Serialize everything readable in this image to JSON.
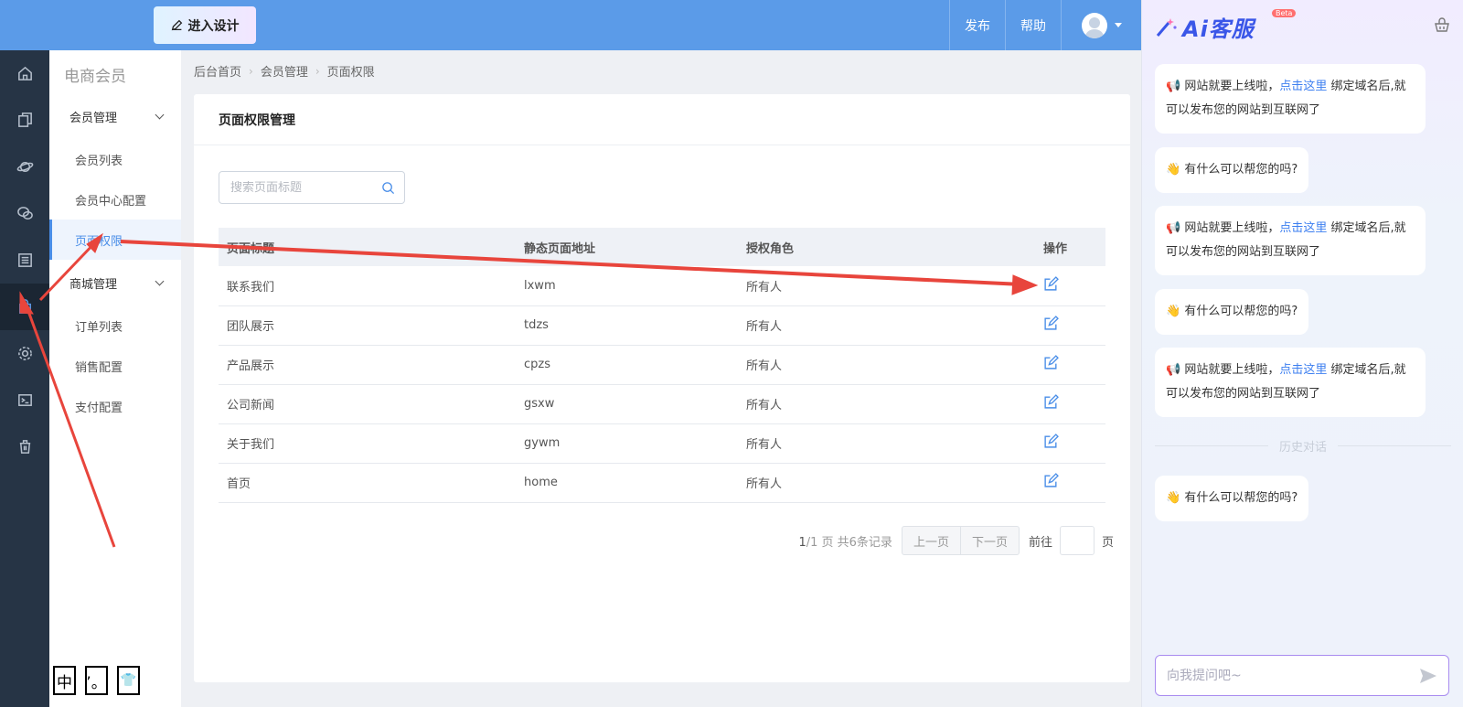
{
  "topbar": {
    "design_button": "进入设计",
    "publish": "发布",
    "help": "帮助"
  },
  "subnav": {
    "title": "电商会员",
    "groups": [
      {
        "label": "会员管理",
        "items": [
          "会员列表",
          "会员中心配置",
          "页面权限"
        ]
      },
      {
        "label": "商城管理",
        "items": [
          "订单列表",
          "销售配置",
          "支付配置"
        ]
      }
    ],
    "lang_buttons": [
      "中",
      "’。",
      "👕"
    ]
  },
  "breadcrumb": [
    "后台首页",
    "会员管理",
    "页面权限"
  ],
  "card": {
    "title": "页面权限管理",
    "search_placeholder": "搜索页面标题"
  },
  "table": {
    "headers": [
      "页面标题",
      "静态页面地址",
      "授权角色",
      "操作"
    ],
    "rows": [
      [
        "联系我们",
        "lxwm",
        "所有人"
      ],
      [
        "团队展示",
        "tdzs",
        "所有人"
      ],
      [
        "产品展示",
        "cpzs",
        "所有人"
      ],
      [
        "公司新闻",
        "gsxw",
        "所有人"
      ],
      [
        "关于我们",
        "gywm",
        "所有人"
      ],
      [
        "首页",
        "home",
        "所有人"
      ]
    ]
  },
  "pager": {
    "current": "1",
    "total_text": "/1 页 共6条记录",
    "prev": "上一页",
    "next": "下一页",
    "goto_label": "前往",
    "page_suffix": "页"
  },
  "ai": {
    "logo": "Ai客服",
    "beta": "Beta",
    "msg_launch_a": "📢 网站就要上线啦，",
    "msg_launch_link": "点击这里",
    "msg_launch_b": "绑定域名后,就可以发布您的网站到互联网了",
    "msg_help": "👋 有什么可以帮您的吗?",
    "history_label": "历史对话",
    "input_placeholder": "向我提问吧~"
  },
  "colors": {
    "topbar": "#5b9be8",
    "rail": "#263445",
    "accent": "#4a8ee8",
    "annotation": "#e8453c"
  }
}
